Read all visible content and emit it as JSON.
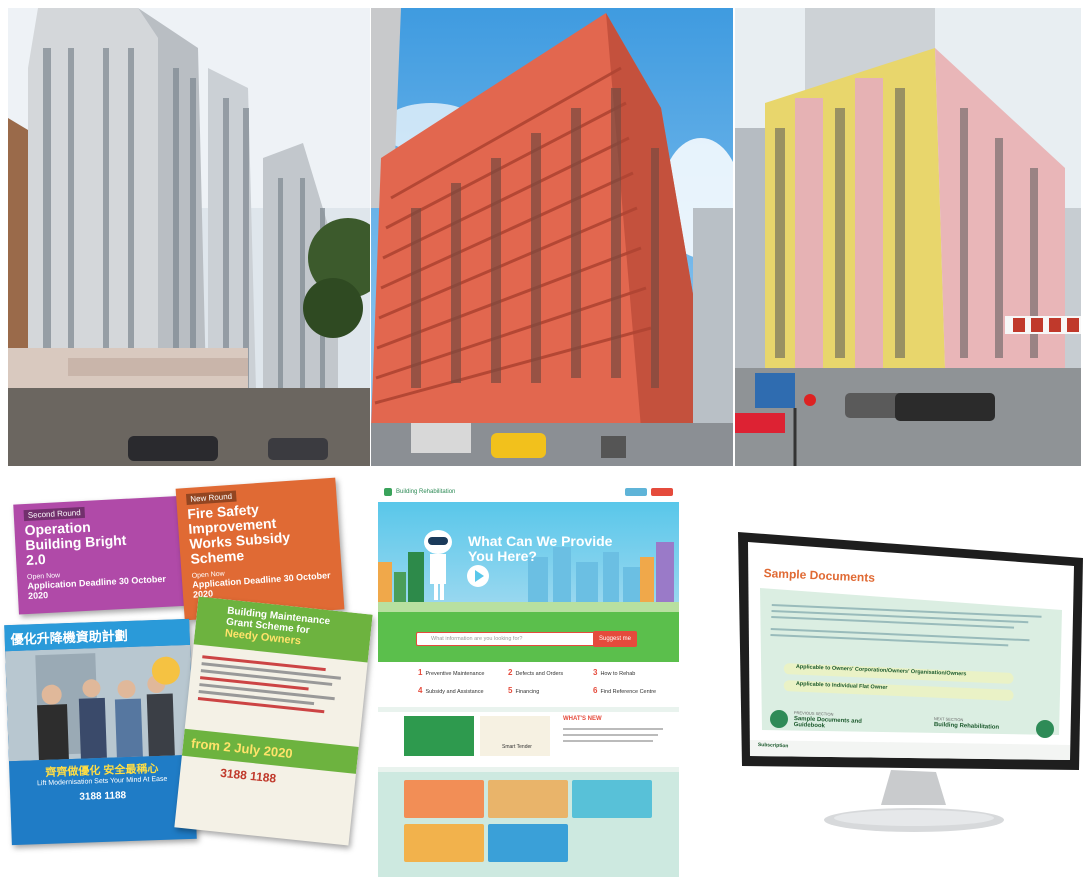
{
  "leaflets": {
    "obb": {
      "tag": "Second Round",
      "title_line1": "Operation",
      "title_line2": "Building Bright",
      "title_line3": "2.0",
      "open_now": "Open Now",
      "deadline": "Application Deadline 30 October 2020"
    },
    "fire": {
      "tag": "New Round",
      "title_line1": "Fire Safety",
      "title_line2": "Improvement",
      "title_line3": "Works Subsidy",
      "title_line4": "Scheme",
      "open_now": "Open Now",
      "deadline": "Application Deadline 30 October 2020"
    },
    "lift": {
      "title_cn": "優化升降機資助計劃",
      "subtitle_cn": "齊齊做優化 安全最稱心",
      "subtitle_en": "Lift Modernisation Sets Your Mind At Ease",
      "hotline": "3188 1188"
    },
    "maint": {
      "title_line1": "Building Maintenance",
      "title_line2": "Grant Scheme for",
      "title_line3": "Needy Owners",
      "date": "from 2 July 2020",
      "hotline": "3188 1188"
    }
  },
  "website": {
    "header_title": "Building Rehabilitation",
    "hero_title_line1": "What Can We Provide",
    "hero_title_line2": "You Here?",
    "search_placeholder": "What information are you looking for?",
    "search_button": "Suggest me",
    "links": [
      {
        "num": "1",
        "label": "Preventive Maintenance"
      },
      {
        "num": "2",
        "label": "Defects and Orders"
      },
      {
        "num": "3",
        "label": "How to Rehab"
      },
      {
        "num": "4",
        "label": "Subsidy and Assistance"
      },
      {
        "num": "5",
        "label": "Financing"
      },
      {
        "num": "6",
        "label": "Find Reference Centre"
      }
    ],
    "news_title": "WHAT'S NEW",
    "news_label": "Smart Tender"
  },
  "monitor": {
    "page_title": "Sample Documents",
    "button1": "Applicable to Owners' Corporation/Owners' Organisation/Owners",
    "button2": "Applicable to Individual Flat Owner",
    "prev_label": "PREVIOUS SECTION",
    "prev_link_line1": "Sample Documents and",
    "prev_link_line2": "Guidebook",
    "next_label": "NEXT SECTION",
    "next_link": "Building Rehabilitation",
    "subscription": "Subscription"
  },
  "colors": {
    "obb_purple": "#b04aa8",
    "fire_orange": "#e06a34",
    "lift_blue": "#1f7cc6",
    "maint_green": "#6db33f",
    "site_green": "#3aa35b",
    "site_red": "#e54b3c",
    "hero_sky": "#59c7ea"
  }
}
